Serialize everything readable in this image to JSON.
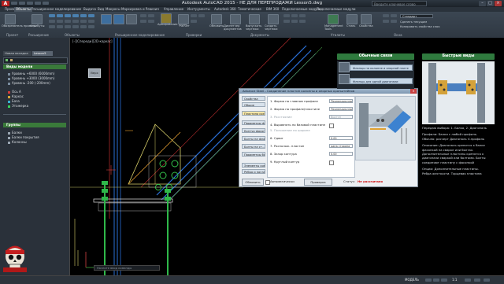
{
  "window": {
    "title": "Autodesk AutoCAD 2015 - НЕ ДЛЯ ПЕРЕПРОДАЖИ    Lesson5.dwg",
    "app_letter": "A",
    "search_placeholder": "Введите ключевое слово"
  },
  "ribbon": {
    "tabs": [
      "Проект",
      "Объекты",
      "Расширенное моделирование",
      "Выдача",
      "Вид",
      "Макросы",
      "Маркировка и Ревизия",
      "Управление",
      "Инструменты",
      "Autodesk 360",
      "Тематические",
      "BIM 360",
      "Подключаемые модули",
      "Подключаемые модули"
    ],
    "active_tab": 1,
    "groups": [
      "Проект",
      "Расширение",
      "Объекты",
      "Расширенное моделирование",
      "Проверки",
      "Документы",
      "Утилиты",
      "Окна"
    ],
    "buttons": {
      "b1": "Обозреватель проекта",
      "b2": "Атрибуты",
      "b3": "Армирование узлов",
      "b4": "Расчет",
      "b5": "Обновить",
      "b6": "Диспетчер документов",
      "b7": "Выпускать чертежи",
      "b8": "Создать чертежи",
      "b9": "Management Tools",
      "b10": "Стиль",
      "b11": "Свойства"
    },
    "right_small": [
      "Стандарт",
      "Сделать текущим",
      "Копировать свойства слоя"
    ]
  },
  "left_palette": {
    "tabs": [
      "Новая вкладка",
      "Lesson5"
    ],
    "section_views": "Виды модели",
    "levels": [
      "Уровень +6000 (6000mm)",
      "Уровень +3000 (3000mm)",
      "Уровень -200 (-200mm)"
    ],
    "axes": [
      {
        "label": "Ось А",
        "color": "#d23a3a"
      },
      {
        "label": "Каркас",
        "color": "#d2a53a"
      },
      {
        "label": "База",
        "color": "#3ab0d2"
      },
      {
        "label": "Этажерка",
        "color": "#3ad25a"
      }
    ],
    "section_groups": "Группы",
    "groups": [
      "Балки",
      "Балки покрытия",
      "Колонны"
    ]
  },
  "viewport": {
    "label": "[-][Спереди][2D-каркас]",
    "cube_label": "Верх"
  },
  "dialog": {
    "title": "Advance Steel - Соединение пластин колонны и опорных кронштейнов",
    "nav": [
      "Свойства",
      "Общие",
      "Пластина соединения",
      "Параметры фа...",
      "Контур фасон...",
      "Болты на фланце",
      "Болты на ст...",
      "Параметры бо...",
      "Элементы соеди...",
      "Ребра и нагладка"
    ],
    "params": [
      {
        "label": "1. Форма на главном профиле",
        "value": "Перпендикуляр"
      },
      {
        "label": "2. Форма на профиле/пластине",
        "value": "Перпендикуляр"
      },
      {
        "label": "3. Расстояние",
        "value": "Выступ"
      },
      {
        "label": "4. Выравнять по базовой пластине",
        "value": ""
      },
      {
        "label": "5. Положение по ширине",
        "value": ""
      },
      {
        "label": "6. Сдвиг",
        "value": "0.00"
      },
      {
        "label": "7. Располож. пластин",
        "value": "одна сторона"
      },
      {
        "label": "8. Зазор контура",
        "value": "0.00"
      },
      {
        "label": "9. Круглый контур",
        "value": ""
      }
    ],
    "update_label": "Обновить",
    "auto_label": "Автоматически",
    "check_label": "Проверка",
    "status_label": "Статус:",
    "status_value": "Не рассчитано"
  },
  "connections_panel": {
    "title": "Обычные связи",
    "items": [
      "Фланцы на колонне и опорной плите",
      "Фланцы для одной диагонали"
    ]
  },
  "quick_panel": {
    "title": "Быстрые виды",
    "info": [
      "Передаю выбора: 1. Балка, 2. Диагональ",
      "Профили: Балки с любой профиль. Обычно: расчерт Диагональ V-профиль",
      "Описание: Диагональ крепится к балке фасонкой на сварке или болтах. Дополнительные пластины крепятся к диагонали сваркой или болтами. Болты соединяют пластину с фасонкой",
      "Опции: Дополнительные пластины. Ребра жесткости. Торцевая пластина"
    ]
  },
  "command_line": "Начните ввод команды",
  "status_bar": {
    "model": "МОДЕЛЬ",
    "scale": "1:1"
  },
  "colors": {
    "accent_green": "#2f7a3e",
    "steel_blue": "#2a6fd6",
    "bolt_green": "#34c24a",
    "status_red": "#d01010"
  }
}
